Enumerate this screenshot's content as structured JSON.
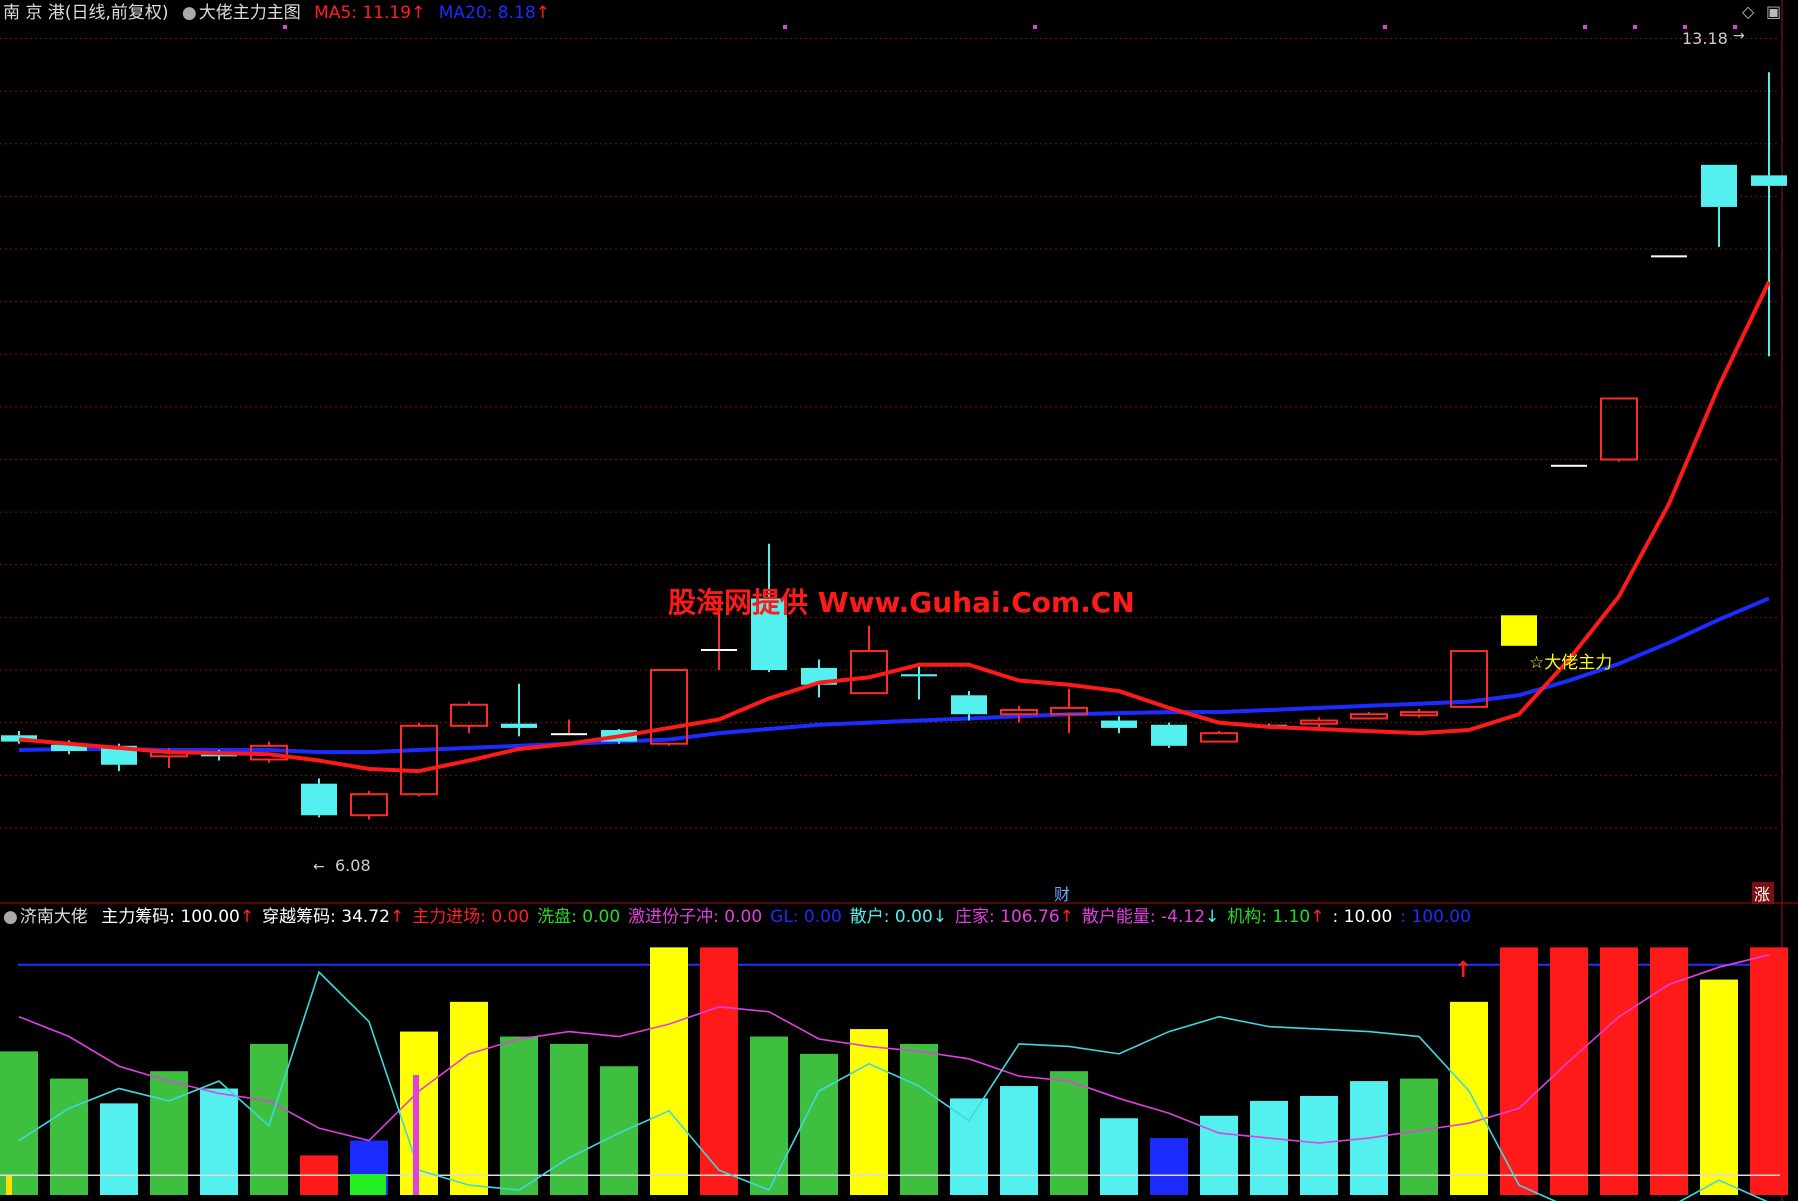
{
  "header": {
    "stock": "南 京 港",
    "period": "(日线,前复权)",
    "indicator": "大佬主力主图",
    "ma5_label": "MA5: 11.19",
    "ma5_color": "#ff2020",
    "ma20_label": "MA20: 8.18",
    "ma20_color": "#1c2cff"
  },
  "watermark": "股海网提供 Www.Guhai.Com.CN",
  "signal_label": "☆大佬主力",
  "high_label": "13.18",
  "low_label": "6.08",
  "fin_marker": "财",
  "rise_marker": "涨",
  "sub_header": {
    "name": "济南大佬",
    "items": [
      {
        "text": "主力筹码: 100.00",
        "color": "#ffffff",
        "arrow": "↑",
        "arrow_color": "#ff2020"
      },
      {
        "text": "穿越筹码: 34.72",
        "color": "#ffffff",
        "arrow": "↑",
        "arrow_color": "#ff2020"
      },
      {
        "text": "主力进场: 0.00",
        "color": "#ff2020",
        "arrow": "",
        "arrow_color": ""
      },
      {
        "text": "洗盘: 0.00",
        "color": "#22dd22",
        "arrow": "",
        "arrow_color": ""
      },
      {
        "text": "激进份子冲: 0.00",
        "color": "#e040e0",
        "arrow": "",
        "arrow_color": ""
      },
      {
        "text": "GL: 0.00",
        "color": "#1c2cff",
        "arrow": "",
        "arrow_color": ""
      },
      {
        "text": "散户: 0.00",
        "color": "#50f0f0",
        "arrow": "↓",
        "arrow_color": "#50f0f0"
      },
      {
        "text": "庄家: 106.76",
        "color": "#e040e0",
        "arrow": "↑",
        "arrow_color": "#ff2020"
      },
      {
        "text": "散户能量: -4.12",
        "color": "#e040e0",
        "arrow": "↓",
        "arrow_color": "#50f0f0"
      },
      {
        "text": "机构: 1.10",
        "color": "#22dd22",
        "arrow": "↑",
        "arrow_color": "#ff2020"
      },
      {
        "text": ": 10.00",
        "color": "#ffffff",
        "arrow": "",
        "arrow_color": ""
      },
      {
        "text": ": 100.00",
        "color": "#1c2cff",
        "arrow": "",
        "arrow_color": ""
      }
    ]
  },
  "colors": {
    "up_candle": "#ff2a2a",
    "down_candle": "#54f0f0",
    "ma5": "#ff1a1a",
    "ma20": "#1c2cff",
    "signal": "#ffff00",
    "grid": "#7a1010"
  },
  "chart_data": [
    {
      "type": "candlestick",
      "title": "大佬主力主图",
      "ylim": [
        5.6,
        13.6
      ],
      "candles": [
        {
          "o": 6.88,
          "h": 6.92,
          "l": 6.8,
          "c": 6.82
        },
        {
          "o": 6.79,
          "h": 6.83,
          "l": 6.7,
          "c": 6.73
        },
        {
          "o": 6.78,
          "h": 6.8,
          "l": 6.54,
          "c": 6.6
        },
        {
          "o": 6.68,
          "h": 6.76,
          "l": 6.57,
          "c": 6.72
        },
        {
          "o": 6.7,
          "h": 6.74,
          "l": 6.64,
          "c": 6.68
        },
        {
          "o": 6.65,
          "h": 6.82,
          "l": 6.62,
          "c": 6.78
        },
        {
          "o": 6.42,
          "h": 6.47,
          "l": 6.1,
          "c": 6.12
        },
        {
          "o": 6.12,
          "h": 6.35,
          "l": 6.08,
          "c": 6.32
        },
        {
          "o": 6.32,
          "h": 7.0,
          "l": 6.3,
          "c": 6.97
        },
        {
          "o": 6.97,
          "h": 7.2,
          "l": 6.9,
          "c": 7.17
        },
        {
          "o": 6.99,
          "h": 7.37,
          "l": 6.87,
          "c": 6.95
        },
        {
          "o": 6.9,
          "h": 7.03,
          "l": 6.88,
          "c": 6.9
        },
        {
          "o": 6.93,
          "h": 6.94,
          "l": 6.8,
          "c": 6.82
        },
        {
          "o": 6.8,
          "h": 7.5,
          "l": 6.78,
          "c": 7.5
        },
        {
          "o": 7.7,
          "h": 8.2,
          "l": 7.5,
          "c": 7.7
        },
        {
          "o": 8.18,
          "h": 8.7,
          "l": 7.48,
          "c": 7.5
        },
        {
          "o": 7.52,
          "h": 7.6,
          "l": 7.24,
          "c": 7.36
        },
        {
          "o": 7.28,
          "h": 7.92,
          "l": 7.28,
          "c": 7.68
        },
        {
          "o": 7.46,
          "h": 7.54,
          "l": 7.22,
          "c": 7.44
        },
        {
          "o": 7.26,
          "h": 7.3,
          "l": 7.02,
          "c": 7.08
        },
        {
          "o": 7.08,
          "h": 7.16,
          "l": 7.0,
          "c": 7.12
        },
        {
          "o": 7.08,
          "h": 7.32,
          "l": 6.9,
          "c": 7.14
        },
        {
          "o": 7.02,
          "h": 7.06,
          "l": 6.9,
          "c": 6.95
        },
        {
          "o": 6.98,
          "h": 7.0,
          "l": 6.76,
          "c": 6.78
        },
        {
          "o": 6.82,
          "h": 6.92,
          "l": 6.82,
          "c": 6.9
        },
        {
          "o": 6.98,
          "h": 6.99,
          "l": 6.96,
          "c": 6.97
        },
        {
          "o": 6.99,
          "h": 7.05,
          "l": 6.94,
          "c": 7.02
        },
        {
          "o": 7.04,
          "h": 7.1,
          "l": 7.03,
          "c": 7.08
        },
        {
          "o": 7.07,
          "h": 7.13,
          "l": 7.05,
          "c": 7.1
        },
        {
          "o": 7.15,
          "h": 7.68,
          "l": 7.14,
          "c": 7.68
        },
        {
          "o": 7.99,
          "h": 7.99,
          "l": 7.99,
          "c": 7.99
        },
        {
          "o": 9.45,
          "h": 9.45,
          "l": 9.45,
          "c": 9.45
        },
        {
          "o": 9.5,
          "h": 10.08,
          "l": 9.48,
          "c": 10.08
        },
        {
          "o": 11.44,
          "h": 11.44,
          "l": 11.44,
          "c": 11.44
        },
        {
          "o": 12.3,
          "h": 12.3,
          "l": 11.52,
          "c": 11.9
        },
        {
          "o": 12.2,
          "h": 13.18,
          "l": 10.48,
          "c": 12.1
        }
      ],
      "ma5": [
        6.84,
        6.8,
        6.76,
        6.72,
        6.71,
        6.7,
        6.64,
        6.56,
        6.54,
        6.64,
        6.75,
        6.8,
        6.87,
        6.95,
        7.03,
        7.23,
        7.38,
        7.43,
        7.55,
        7.55,
        7.4,
        7.36,
        7.3,
        7.14,
        7.0,
        6.96,
        6.94,
        6.92,
        6.9,
        6.93,
        7.08,
        7.6,
        8.2,
        9.08,
        10.2,
        11.19
      ],
      "ma20": [
        6.74,
        6.75,
        6.75,
        6.74,
        6.74,
        6.74,
        6.72,
        6.72,
        6.74,
        6.76,
        6.78,
        6.8,
        6.82,
        6.84,
        6.9,
        6.94,
        6.98,
        7.0,
        7.02,
        7.04,
        7.06,
        7.08,
        7.09,
        7.1,
        7.1,
        7.12,
        7.14,
        7.16,
        7.18,
        7.2,
        7.26,
        7.4,
        7.56,
        7.76,
        7.98,
        8.18
      ],
      "signal_index": 30,
      "signal_range": [
        7.73,
        8.02
      ],
      "low_index": 6,
      "high_index": 35,
      "top_markers": [
        5,
        15,
        20,
        27,
        31,
        32,
        33,
        34
      ]
    },
    {
      "type": "bar",
      "title": "济南大佬",
      "ylim": [
        0,
        105
      ],
      "values": [
        58,
        47,
        37,
        50,
        43,
        61,
        16,
        22,
        66,
        78,
        64,
        61,
        52,
        100,
        100,
        64,
        57,
        67,
        61,
        39,
        44,
        50,
        31,
        23,
        32,
        38,
        40,
        46,
        47,
        78,
        100,
        100,
        100,
        100,
        87,
        100
      ],
      "bar_colors": [
        "g",
        "g",
        "c",
        "g",
        "c",
        "g",
        "r",
        "b",
        "y",
        "y",
        "g",
        "g",
        "g",
        "y",
        "r",
        "g",
        "g",
        "y",
        "g",
        "c",
        "c",
        "g",
        "c",
        "b",
        "c",
        "c",
        "c",
        "c",
        "g",
        "y",
        "r",
        "r",
        "r",
        "r",
        "y",
        "r"
      ],
      "cyan_line": [
        22,
        35,
        43,
        38,
        46,
        28,
        90,
        70,
        10,
        4,
        2,
        15,
        25,
        34,
        10,
        2,
        42,
        53,
        44,
        30,
        61,
        60,
        57,
        66,
        72,
        68,
        67,
        66,
        64,
        42,
        4,
        -5,
        -5,
        -5,
        6,
        -3
      ],
      "magenta_line": [
        72,
        64,
        52,
        46,
        41,
        38,
        27,
        22,
        42,
        57,
        63,
        66,
        64,
        69,
        76,
        74,
        63,
        60,
        58,
        55,
        48,
        46,
        39,
        33,
        25,
        23,
        21,
        23,
        26,
        29,
        35,
        54,
        72,
        85,
        92,
        97
      ],
      "ref_line": 93,
      "base_line": 8
    }
  ]
}
